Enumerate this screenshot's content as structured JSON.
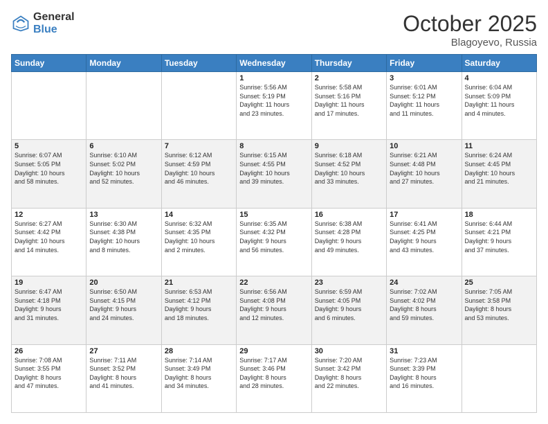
{
  "header": {
    "logo_general": "General",
    "logo_blue": "Blue",
    "title": "October 2025",
    "location": "Blagoyevo, Russia"
  },
  "days_of_week": [
    "Sunday",
    "Monday",
    "Tuesday",
    "Wednesday",
    "Thursday",
    "Friday",
    "Saturday"
  ],
  "weeks": [
    [
      {
        "day": "",
        "info": ""
      },
      {
        "day": "",
        "info": ""
      },
      {
        "day": "",
        "info": ""
      },
      {
        "day": "1",
        "info": "Sunrise: 5:56 AM\nSunset: 5:19 PM\nDaylight: 11 hours\nand 23 minutes."
      },
      {
        "day": "2",
        "info": "Sunrise: 5:58 AM\nSunset: 5:16 PM\nDaylight: 11 hours\nand 17 minutes."
      },
      {
        "day": "3",
        "info": "Sunrise: 6:01 AM\nSunset: 5:12 PM\nDaylight: 11 hours\nand 11 minutes."
      },
      {
        "day": "4",
        "info": "Sunrise: 6:04 AM\nSunset: 5:09 PM\nDaylight: 11 hours\nand 4 minutes."
      }
    ],
    [
      {
        "day": "5",
        "info": "Sunrise: 6:07 AM\nSunset: 5:05 PM\nDaylight: 10 hours\nand 58 minutes."
      },
      {
        "day": "6",
        "info": "Sunrise: 6:10 AM\nSunset: 5:02 PM\nDaylight: 10 hours\nand 52 minutes."
      },
      {
        "day": "7",
        "info": "Sunrise: 6:12 AM\nSunset: 4:59 PM\nDaylight: 10 hours\nand 46 minutes."
      },
      {
        "day": "8",
        "info": "Sunrise: 6:15 AM\nSunset: 4:55 PM\nDaylight: 10 hours\nand 39 minutes."
      },
      {
        "day": "9",
        "info": "Sunrise: 6:18 AM\nSunset: 4:52 PM\nDaylight: 10 hours\nand 33 minutes."
      },
      {
        "day": "10",
        "info": "Sunrise: 6:21 AM\nSunset: 4:48 PM\nDaylight: 10 hours\nand 27 minutes."
      },
      {
        "day": "11",
        "info": "Sunrise: 6:24 AM\nSunset: 4:45 PM\nDaylight: 10 hours\nand 21 minutes."
      }
    ],
    [
      {
        "day": "12",
        "info": "Sunrise: 6:27 AM\nSunset: 4:42 PM\nDaylight: 10 hours\nand 14 minutes."
      },
      {
        "day": "13",
        "info": "Sunrise: 6:30 AM\nSunset: 4:38 PM\nDaylight: 10 hours\nand 8 minutes."
      },
      {
        "day": "14",
        "info": "Sunrise: 6:32 AM\nSunset: 4:35 PM\nDaylight: 10 hours\nand 2 minutes."
      },
      {
        "day": "15",
        "info": "Sunrise: 6:35 AM\nSunset: 4:32 PM\nDaylight: 9 hours\nand 56 minutes."
      },
      {
        "day": "16",
        "info": "Sunrise: 6:38 AM\nSunset: 4:28 PM\nDaylight: 9 hours\nand 49 minutes."
      },
      {
        "day": "17",
        "info": "Sunrise: 6:41 AM\nSunset: 4:25 PM\nDaylight: 9 hours\nand 43 minutes."
      },
      {
        "day": "18",
        "info": "Sunrise: 6:44 AM\nSunset: 4:21 PM\nDaylight: 9 hours\nand 37 minutes."
      }
    ],
    [
      {
        "day": "19",
        "info": "Sunrise: 6:47 AM\nSunset: 4:18 PM\nDaylight: 9 hours\nand 31 minutes."
      },
      {
        "day": "20",
        "info": "Sunrise: 6:50 AM\nSunset: 4:15 PM\nDaylight: 9 hours\nand 24 minutes."
      },
      {
        "day": "21",
        "info": "Sunrise: 6:53 AM\nSunset: 4:12 PM\nDaylight: 9 hours\nand 18 minutes."
      },
      {
        "day": "22",
        "info": "Sunrise: 6:56 AM\nSunset: 4:08 PM\nDaylight: 9 hours\nand 12 minutes."
      },
      {
        "day": "23",
        "info": "Sunrise: 6:59 AM\nSunset: 4:05 PM\nDaylight: 9 hours\nand 6 minutes."
      },
      {
        "day": "24",
        "info": "Sunrise: 7:02 AM\nSunset: 4:02 PM\nDaylight: 8 hours\nand 59 minutes."
      },
      {
        "day": "25",
        "info": "Sunrise: 7:05 AM\nSunset: 3:58 PM\nDaylight: 8 hours\nand 53 minutes."
      }
    ],
    [
      {
        "day": "26",
        "info": "Sunrise: 7:08 AM\nSunset: 3:55 PM\nDaylight: 8 hours\nand 47 minutes."
      },
      {
        "day": "27",
        "info": "Sunrise: 7:11 AM\nSunset: 3:52 PM\nDaylight: 8 hours\nand 41 minutes."
      },
      {
        "day": "28",
        "info": "Sunrise: 7:14 AM\nSunset: 3:49 PM\nDaylight: 8 hours\nand 34 minutes."
      },
      {
        "day": "29",
        "info": "Sunrise: 7:17 AM\nSunset: 3:46 PM\nDaylight: 8 hours\nand 28 minutes."
      },
      {
        "day": "30",
        "info": "Sunrise: 7:20 AM\nSunset: 3:42 PM\nDaylight: 8 hours\nand 22 minutes."
      },
      {
        "day": "31",
        "info": "Sunrise: 7:23 AM\nSunset: 3:39 PM\nDaylight: 8 hours\nand 16 minutes."
      },
      {
        "day": "",
        "info": ""
      }
    ]
  ]
}
